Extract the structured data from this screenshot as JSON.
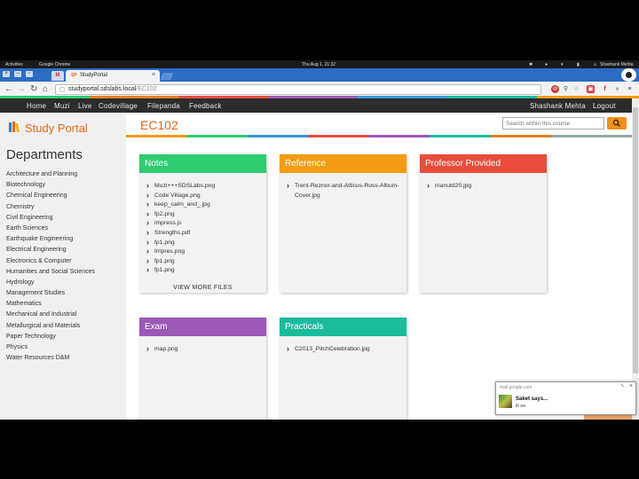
{
  "os_bar": {
    "activities": "Activities",
    "app": "Google Chrome",
    "clock": "Thu Aug 1, 21:32",
    "user": "Shashank Mehta"
  },
  "browser": {
    "tab_title": "StudyPortal",
    "tab_favicon": "SP",
    "url_host": "studyportal.sdslabs.local",
    "url_path": "/EC102"
  },
  "nav": {
    "left": [
      "Home",
      "Muzi",
      "Live",
      "Codevillage",
      "Filepanda",
      "Feedback"
    ],
    "user": "Shashank Mehta",
    "logout": "Logout"
  },
  "sidebar": {
    "logo": "Study Portal",
    "title": "Departments",
    "departments": [
      "Architecture and Planning",
      "Biotechnology",
      "Chemical Engineering",
      "Chemistry",
      "Civil Engineering",
      "Earth Sciences",
      "Earthquake Engineering",
      "Electrical Engineering",
      "Electronics & Computer",
      "Humanities and Social Sciences",
      "Hydrology",
      "Management Studies",
      "Mathematics",
      "Mechanical and Industrial",
      "Metallurgical and Materials",
      "Paper Technology",
      "Physics",
      "Water Resources D&M"
    ]
  },
  "main": {
    "course": "EC102",
    "search_placeholder": "Search within this course"
  },
  "cards": [
    {
      "title": "Notes",
      "color": "#2ecc71",
      "files": [
        "Muzi+++SDSLabs.png",
        "Code Village.png",
        "keep_calm_and_.jpg",
        "fp2.png",
        "impress.js",
        "Strengths.pdf",
        "fp1.png",
        "Impres.png",
        "fp1.png",
        "fp1.png"
      ],
      "more": "VIEW MORE FILES"
    },
    {
      "title": "Reference",
      "color": "#f39c12",
      "files": [
        "Trent-Reznor-and-Atticus-Ross-Album-Cover.jpg"
      ]
    },
    {
      "title": "Professor Provided",
      "color": "#e74c3c",
      "files": [
        "manutd20.jpg"
      ]
    },
    {
      "title": "Exam",
      "color": "#9b59b6",
      "files": [
        "map.png"
      ]
    },
    {
      "title": "Practicals",
      "color": "#1abc9c",
      "files": [
        "C2013_PitchCelebration.jpg"
      ]
    }
  ],
  "notification": {
    "source": "mail.google.com",
    "title": "Saket says...",
    "message": "ill so"
  }
}
